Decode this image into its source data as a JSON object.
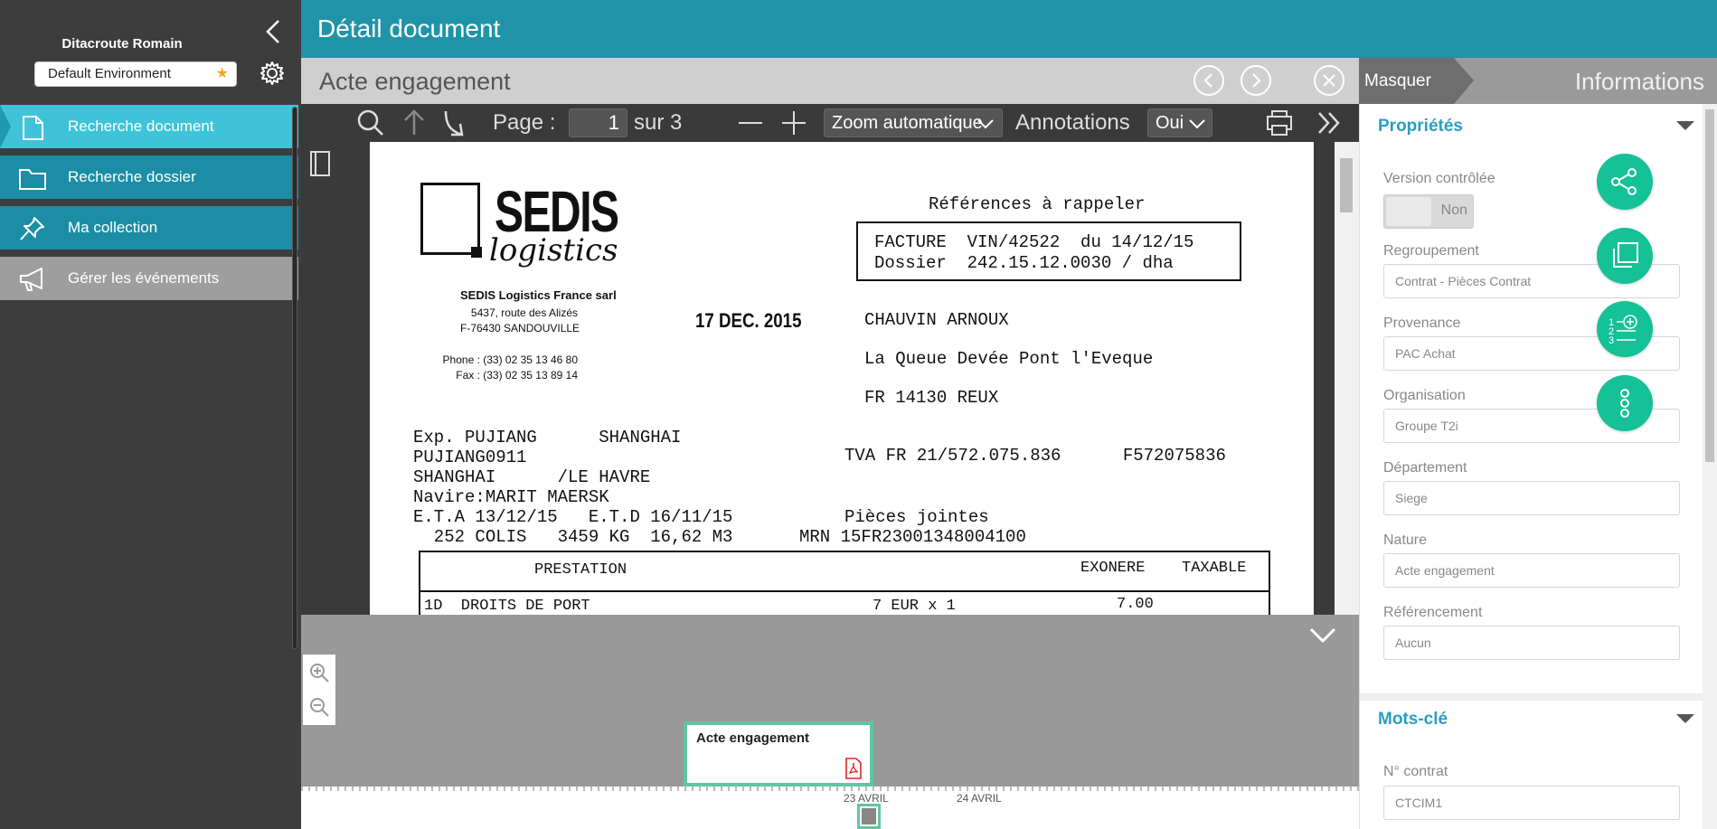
{
  "sidebar": {
    "user_name": "Ditacroute Romain",
    "environment": "Default Environment",
    "nav": [
      {
        "label": "Recherche document",
        "icon": "document-icon"
      },
      {
        "label": "Recherche dossier",
        "icon": "folder-icon"
      },
      {
        "label": "Ma collection",
        "icon": "pin-icon"
      },
      {
        "label": "Gérer les événements",
        "icon": "megaphone-icon"
      }
    ]
  },
  "header": {
    "title": "Détail document"
  },
  "viewer": {
    "doc_title": "Acte engagement",
    "toolbar": {
      "page_label": "Page :",
      "page_value": "1",
      "page_total": "sur 3",
      "zoom": "Zoom automatique",
      "annotations_label": "Annotations",
      "annotations_value": "Oui"
    },
    "document": {
      "brand": "SEDIS",
      "brand_sub": "logistics",
      "company": "SEDIS Logistics France sarl",
      "address1": "5437, route des Alizés",
      "address2": "F-76430 SANDOUVILLE",
      "phone": "Phone : (33) 02 35 13 46 80",
      "fax": "Fax : (33) 02 35 13 89 14",
      "stamp": "17 DEC. 2015",
      "references_title": "Références à rappeler",
      "ref_line1": "FACTURE  VIN/42522  du 14/12/15",
      "ref_line2": "Dossier  242.15.12.0030 / dha",
      "client1": "CHAUVIN ARNOUX",
      "client2": "La Queue Devée Pont l'Eveque",
      "client3": "FR 14130 REUX",
      "exp1": "Exp. PUJIANG      SHANGHAI",
      "exp2": "PUJIANG0911",
      "tva": "TVA FR 21/572.075.836      F572075836",
      "exp3": "SHANGHAI      /LE HAVRE",
      "exp4": "Navire:MARIT MAERSK",
      "exp5": "E.T.A 13/12/15   E.T.D 16/11/15",
      "pieces": "Pièces jointes",
      "exp6": "  252 COLIS   3459 KG  16,62 M3",
      "mrn": "MRN 15FR23001348004100",
      "col_prestation": "PRESTATION",
      "col_exonere": "EXONERE",
      "col_taxable": "TAXABLE",
      "row1_label": "1D  DROITS DE PORT",
      "row1_qty": "7 EUR x 1",
      "row1_val": "7.00"
    }
  },
  "timeline": {
    "card_title": "Acte engagement",
    "axis_labels": [
      "23 AVRIL",
      "24 AVRIL"
    ]
  },
  "panel": {
    "hide_label": "Masquer",
    "title": "Informations",
    "section_properties": "Propriétés",
    "version_label": "Version contrôlée",
    "version_value": "Non",
    "fields": [
      {
        "label": "Regroupement",
        "value": "Contrat - Pièces Contrat"
      },
      {
        "label": "Provenance",
        "value": "PAC Achat"
      },
      {
        "label": "Organisation",
        "value": "Groupe T2i"
      },
      {
        "label": "Département",
        "value": "Siege"
      },
      {
        "label": "Nature",
        "value": "Acte engagement"
      },
      {
        "label": "Référencement",
        "value": "Aucun"
      }
    ],
    "section_keywords": "Mots-clé",
    "contract_label": "N° contrat",
    "contract_value": "CTCIM1"
  },
  "colors": {
    "header": "#1f94a8",
    "sidebar": "#3d3d3d",
    "nav_active": "#3ec3d8",
    "nav_teal": "#1b8ea5",
    "nav_grey": "#9e9e9e",
    "accent_link": "#2a9fc1",
    "fab_green": "#15c196",
    "timeline_highlight": "#61c6a0"
  }
}
